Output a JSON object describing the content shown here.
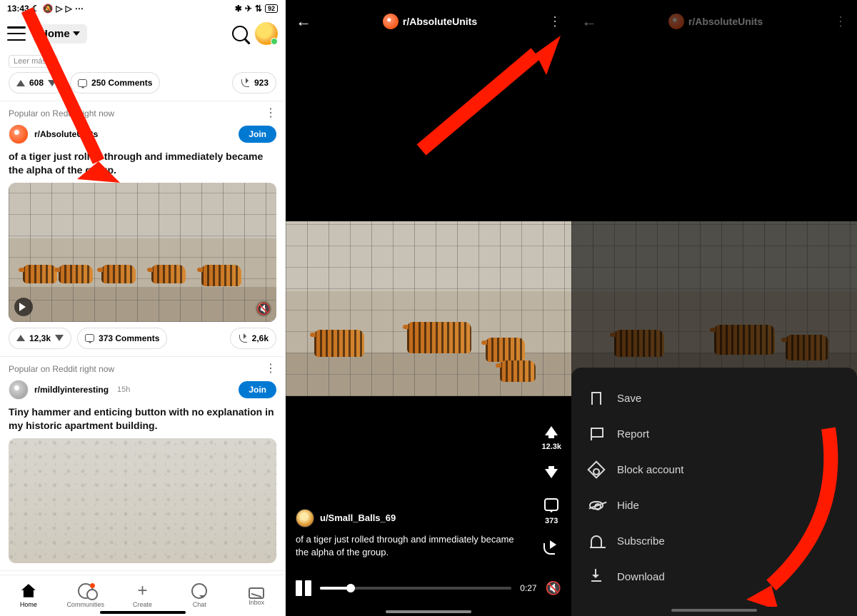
{
  "status": {
    "time": "13:43",
    "battery": "92"
  },
  "topbar": {
    "home_label": "Home"
  },
  "partial_post": {
    "read_more": "Leer más >",
    "upvotes": "608",
    "comments": "250 Comments",
    "shares": "923"
  },
  "section_label": "Popular on Reddit right now",
  "post1": {
    "subreddit": "r/AbsoluteUnits",
    "join": "Join",
    "title": "of a tiger just rolled through and immediately became the alpha of the group.",
    "upvotes": "12,3k",
    "comments": "373 Comments",
    "shares": "2,6k"
  },
  "post2": {
    "subreddit": "r/mildlyinteresting",
    "age": "15h",
    "join": "Join",
    "title": "Tiny hammer and enticing button with no explanation in my historic apartment building."
  },
  "nav": {
    "home": "Home",
    "communities": "Communities",
    "create": "Create",
    "chat": "Chat",
    "inbox": "Inbox"
  },
  "fullscreen": {
    "subreddit": "r/AbsoluteUnits",
    "upvotes": "12.3k",
    "comments": "373",
    "user": "u/Small_Balls_69",
    "title": "of a tiger just rolled through and immediately became the alpha of the group.",
    "time": "0:27"
  },
  "sheet": {
    "save": "Save",
    "report": "Report",
    "block": "Block account",
    "hide": "Hide",
    "subscribe": "Subscribe",
    "download": "Download"
  }
}
